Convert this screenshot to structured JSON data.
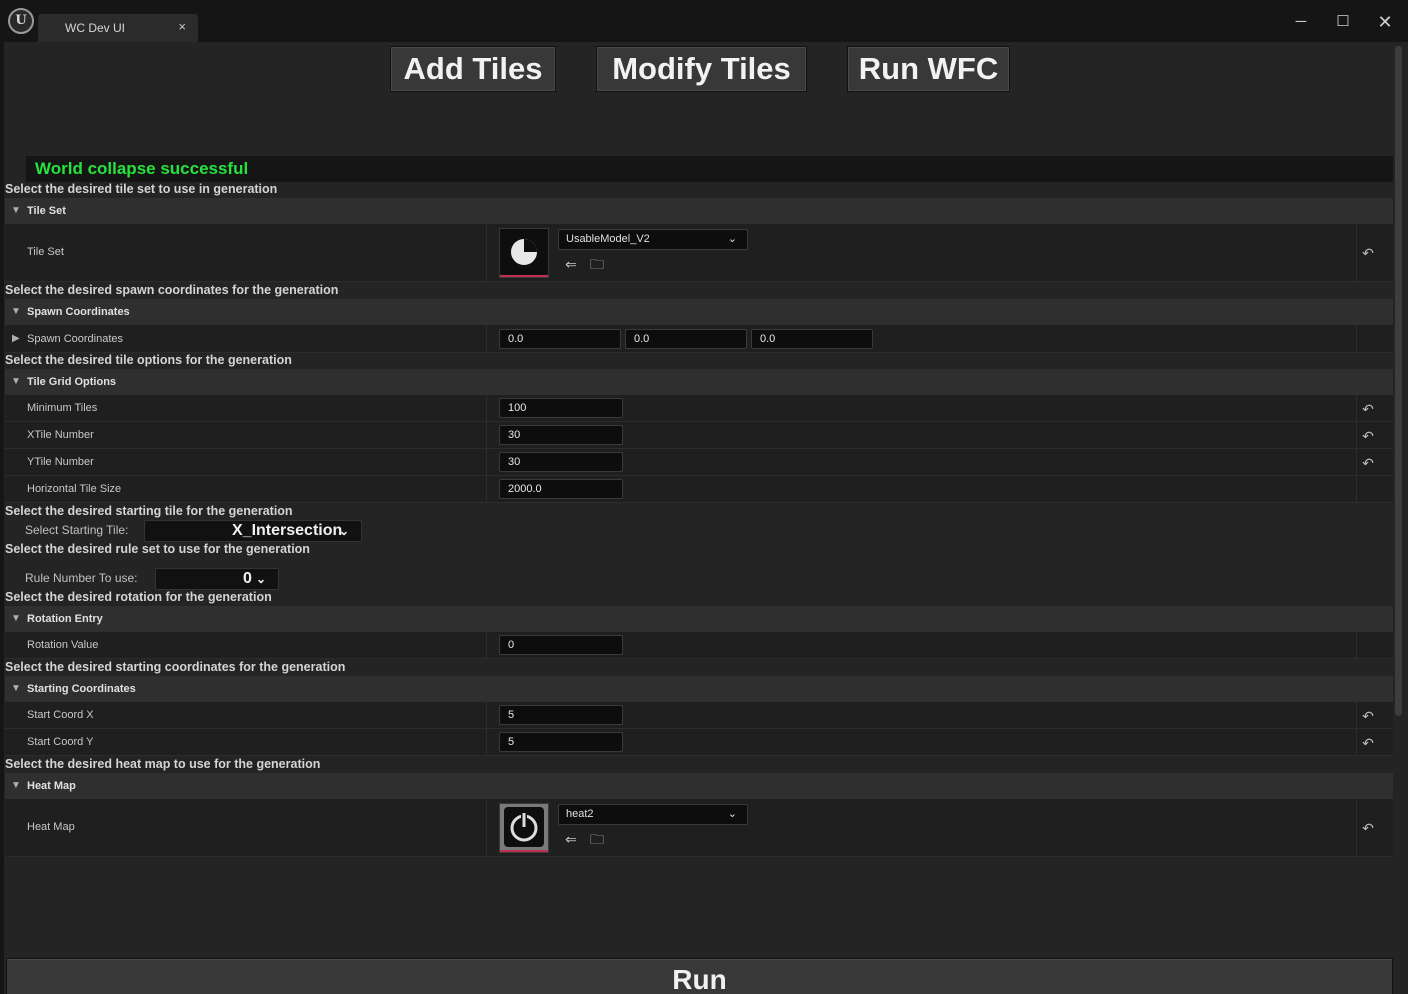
{
  "window": {
    "logo": "U",
    "tab_title": "WC Dev UI",
    "tab_close": "×",
    "minimize": "─",
    "maximize": "☐",
    "close": "✕"
  },
  "toolbar": {
    "add_tiles": "Add Tiles",
    "modify_tiles": "Modify Tiles",
    "run_wfc": "Run WFC"
  },
  "status": {
    "message": "World collapse successful",
    "color": "#27e23b"
  },
  "tile_set": {
    "description": "Select the desired tile set to use in generation",
    "category": "Tile Set",
    "row_label": "Tile Set",
    "asset": "UsableModel_V2",
    "thumbnail_icon": "pie-chart-icon"
  },
  "spawn": {
    "description": "Select the desired spawn coordinates for the generation",
    "category": "Spawn Coordinates",
    "row_label": "Spawn Coordinates",
    "x": "0.0",
    "y": "0.0",
    "z": "0.0"
  },
  "grid": {
    "description": "Select the desired tile options for the generation",
    "category": "Tile Grid Options",
    "min_tiles_label": "Minimum Tiles",
    "min_tiles": "100",
    "xtile_label": "XTile Number",
    "xtile": "30",
    "ytile_label": "YTile Number",
    "ytile": "30",
    "hsize_label": "Horizontal Tile Size",
    "hsize": "2000.0"
  },
  "starting_tile": {
    "description": "Select the desired starting tile for the generation",
    "label": "Select Starting Tile:",
    "value": "X_Intersection"
  },
  "rule_set": {
    "description": "Select the desired rule set to use for the generation",
    "label": "Rule Number To use:",
    "value": "0"
  },
  "rotation": {
    "description": "Select the desired rotation for the generation",
    "category": "Rotation Entry",
    "row_label": "Rotation Value",
    "value": "0"
  },
  "start_coords": {
    "description": "Select the desired starting coordinates for the generation",
    "category": "Starting Coordinates",
    "x_label": "Start Coord X",
    "x": "5",
    "y_label": "Start Coord Y",
    "y": "5"
  },
  "heat_map": {
    "description": "Select the desired heat map to use for the generation",
    "category": "Heat Map",
    "row_label": "Heat Map",
    "asset": "heat2",
    "thumbnail_icon": "power-icon"
  },
  "glyphs": {
    "collapse_arrow": "▼",
    "expand_arrow": "▶",
    "chevron": "⌄",
    "reset": "↶",
    "browse": "⇐",
    "find": "🗀"
  },
  "run": {
    "label": "Run"
  }
}
